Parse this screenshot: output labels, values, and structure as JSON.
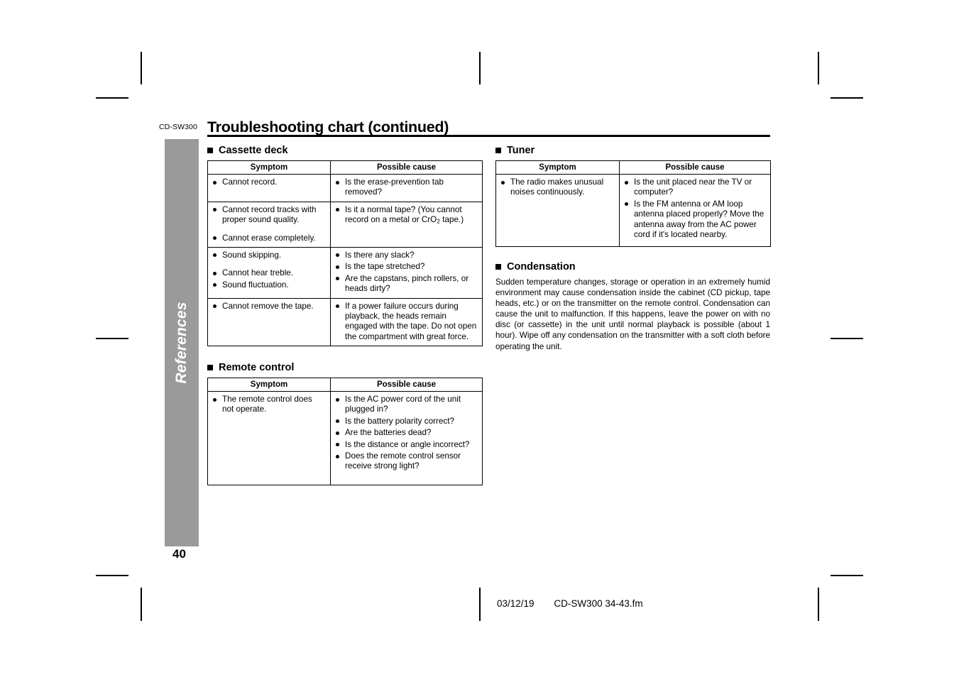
{
  "document": {
    "model_code": "CD-SW300",
    "title": "Troubleshooting chart (continued)",
    "side_tab_label": "References",
    "page_number": "40"
  },
  "colors": {
    "side_tab_bg": "#9a9a9a",
    "side_tab_text": "#ffffff",
    "rule": "#000000"
  },
  "table_headers": {
    "symptom": "Symptom",
    "possible_cause": "Possible cause"
  },
  "sections": {
    "cassette_deck": {
      "heading": "Cassette deck",
      "rows": [
        {
          "symptoms": [
            "Cannot record."
          ],
          "causes": [
            "Is the erase-prevention tab removed?"
          ]
        },
        {
          "symptoms": [
            "Cannot record tracks with proper sound quality.",
            "Cannot erase completely."
          ],
          "causes": [
            "Is it a normal tape? (You cannot record on a metal or CrO₂ tape.)"
          ]
        },
        {
          "symptoms": [
            "Sound skipping.",
            "Cannot hear treble.",
            "Sound fluctuation."
          ],
          "causes": [
            "Is there any slack?",
            "Is the tape stretched?",
            "Are the capstans, pinch rollers, or heads dirty?"
          ]
        },
        {
          "symptoms": [
            "Cannot remove the tape."
          ],
          "causes": [
            "If a power failure occurs during playback, the heads remain engaged with the tape. Do not open the compartment with great force."
          ]
        }
      ]
    },
    "remote_control": {
      "heading": "Remote control",
      "rows": [
        {
          "symptoms": [
            "The remote control does not operate."
          ],
          "causes": [
            "Is the AC power cord of the unit plugged in?",
            "Is the battery polarity correct?",
            "Are the batteries dead?",
            "Is the distance or angle incorrect?",
            "Does the remote control sensor receive strong light?"
          ]
        }
      ]
    },
    "tuner": {
      "heading": "Tuner",
      "rows": [
        {
          "symptoms": [
            "The radio makes unusual noises continuously."
          ],
          "causes": [
            "Is the unit placed near the TV or computer?",
            "Is the FM antenna or AM loop antenna placed properly? Move the antenna away from the AC power cord if it's located nearby."
          ]
        }
      ]
    },
    "condensation": {
      "heading": "Condensation",
      "body": "Sudden temperature changes, storage or operation in an extremely humid environment may cause condensation inside the cabinet (CD pickup, tape heads, etc.) or on the transmitter on the remote control. Condensation can cause the unit to malfunction. If this happens, leave the power on with no disc (or cassette) in the unit until normal playback is possible (about 1 hour). Wipe off any condensation on the transmitter with a soft cloth before operating the unit."
    }
  },
  "footer": {
    "date": "03/12/19",
    "filename": "CD-SW300 34-43.fm"
  }
}
